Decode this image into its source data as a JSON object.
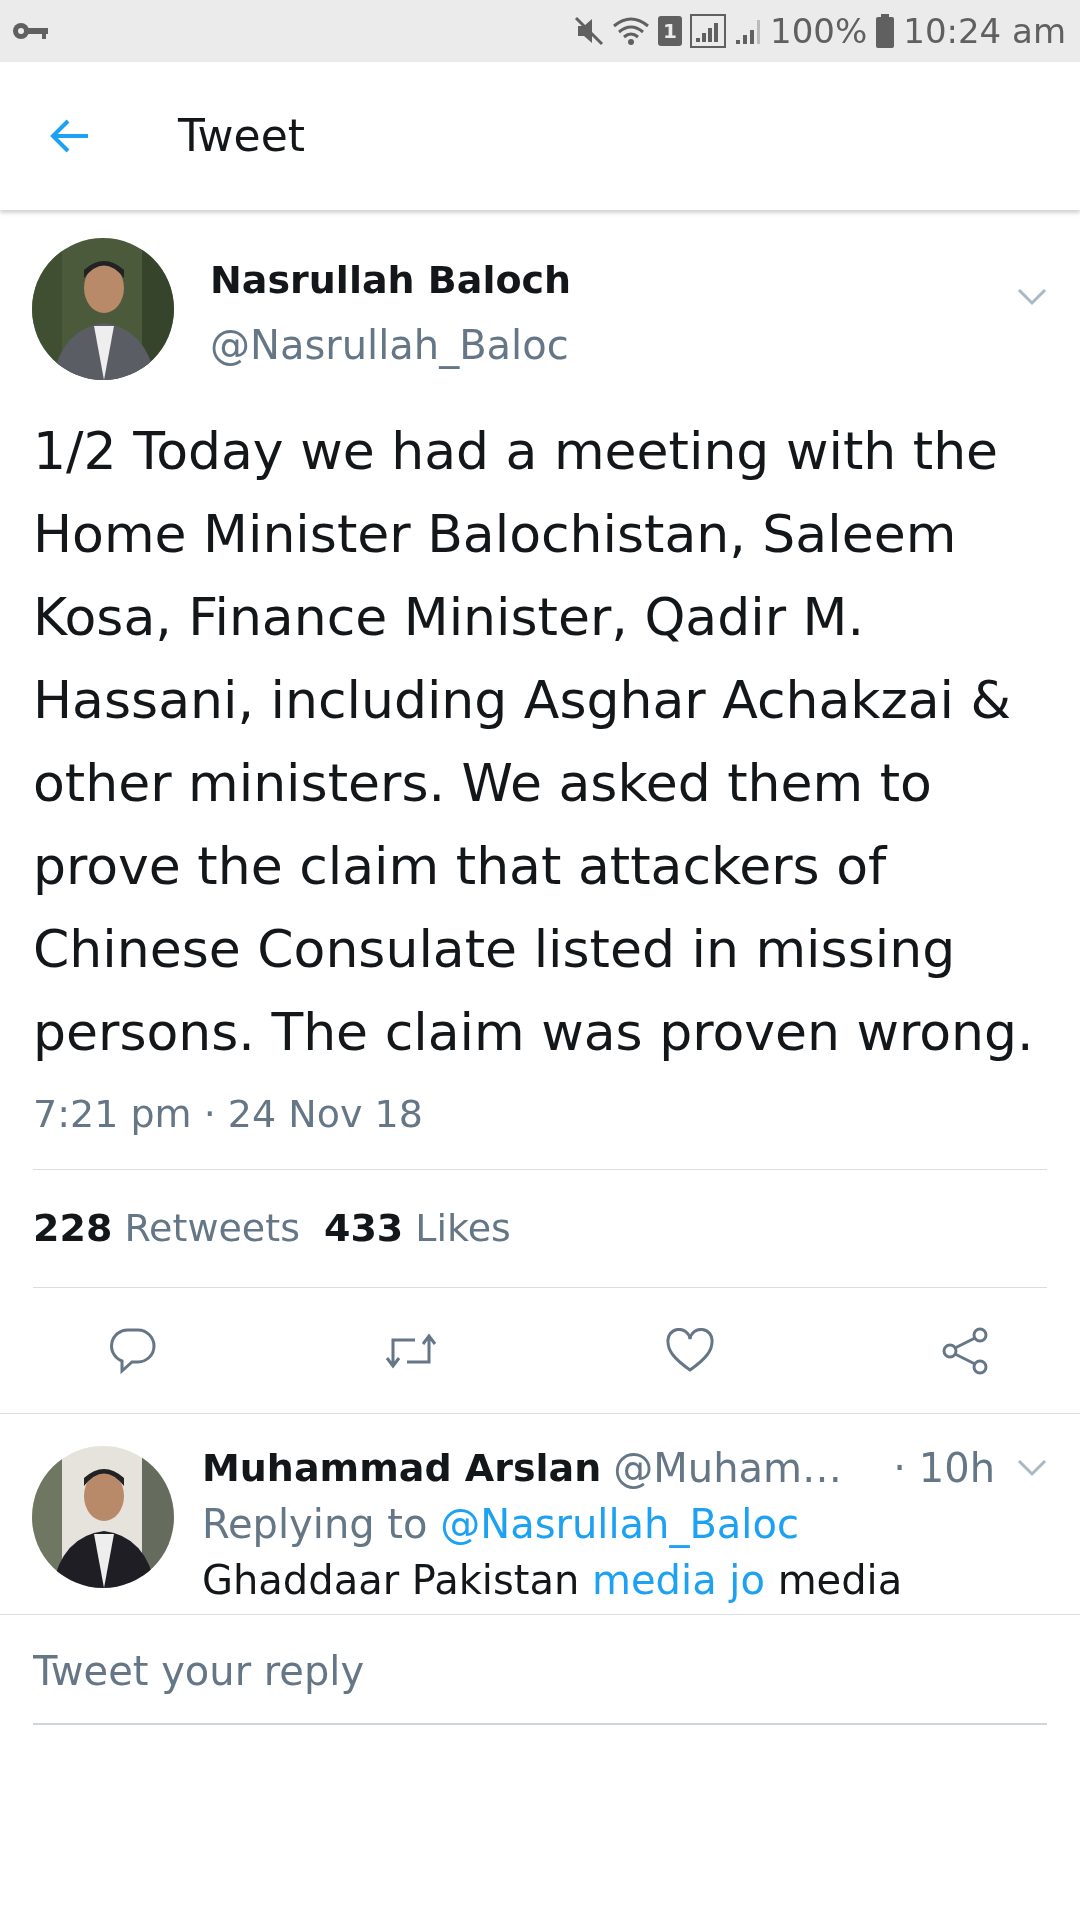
{
  "status_bar": {
    "sim": "1",
    "battery": "100%",
    "time": "10:24 am"
  },
  "header": {
    "title": "Tweet"
  },
  "tweet": {
    "name": "Nasrullah Baloch",
    "handle": "@Nasrullah_Baloc",
    "text": "1/2 Today we had a meeting with the Home Minister Balochistan, Saleem Kosa, Finance Minister, Qadir M. Hassani, including Asghar Achakzai & other ministers. We asked them to prove the claim that attackers of Chinese Consulate listed in missing persons. The claim was proven wrong.",
    "timestamp": "7:21 pm · 24 Nov 18",
    "stats": [
      {
        "count": "228",
        "label": "Retweets"
      },
      {
        "count": "433",
        "label": "Likes"
      }
    ]
  },
  "reply": {
    "name": "Muhammad Arslan",
    "handle": "@Muham…",
    "time": "· 10h",
    "replying_label": "Replying to",
    "replying_handle": "@Nasrullah_Baloc",
    "text": [
      {
        "kind": "plain",
        "text": "Ghaddaar Pakistan"
      },
      {
        "kind": "link",
        "text": "media jo"
      },
      {
        "kind": "plain",
        "text": "media"
      }
    ]
  },
  "composer": {
    "placeholder": "Tweet your reply"
  }
}
